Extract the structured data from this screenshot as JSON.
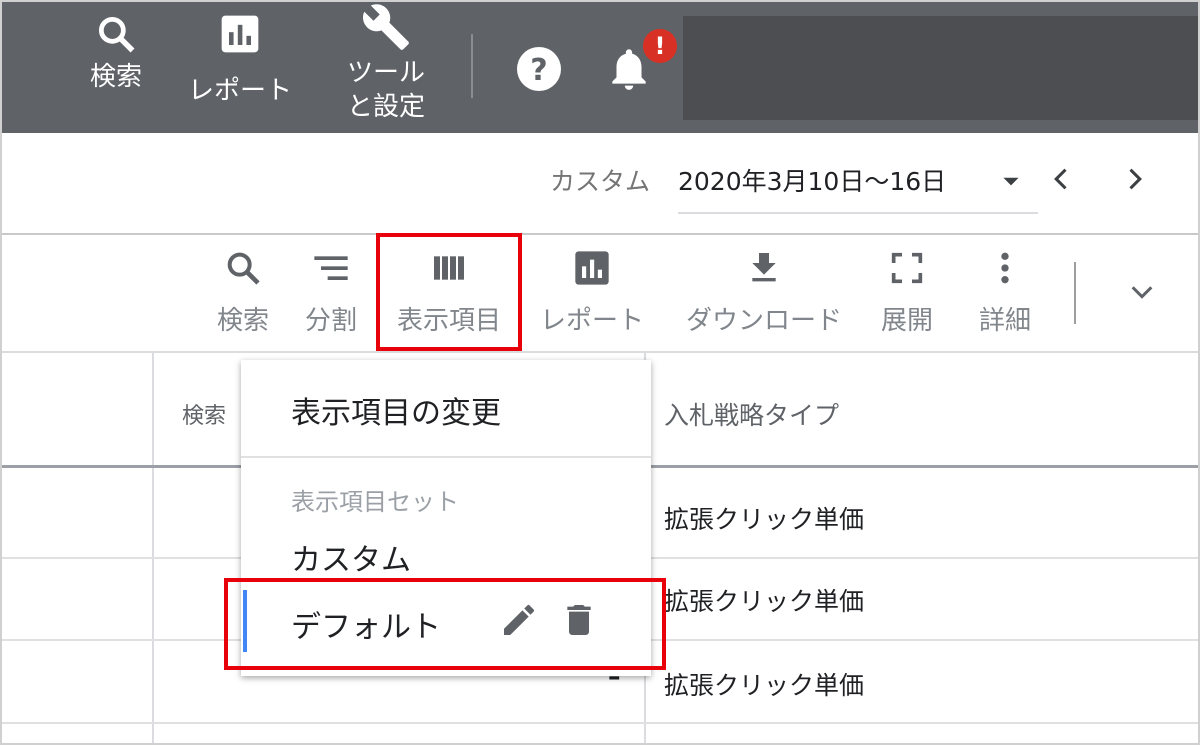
{
  "topbar": {
    "search_label": "検索",
    "reports_label": "レポート",
    "tools_label_line1": "ツール",
    "tools_label_line2": "と設定",
    "notification_badge": "!"
  },
  "date_range": {
    "label": "カスタム",
    "value": "2020年3月10日～16日"
  },
  "toolbar": {
    "search": "検索",
    "segment": "分割",
    "columns": "表示項目",
    "reports": "レポート",
    "download": "ダウンロード",
    "expand": "展開",
    "more": "詳細"
  },
  "table": {
    "header_partial": "検索",
    "header_bid_strategy": "入札戦略タイプ",
    "rows": [
      {
        "bid_strategy": "拡張クリック単価",
        "value": ""
      },
      {
        "bid_strategy": "拡張クリック単価",
        "value": ""
      },
      {
        "bid_strategy": "拡張クリック単価",
        "value": "–"
      }
    ]
  },
  "dropdown": {
    "title": "表示項目の変更",
    "section_label": "表示項目セット",
    "items": [
      "カスタム",
      "デフォルト"
    ]
  },
  "colors": {
    "topbar_bg": "#5f6368",
    "highlight_red": "#e8000b",
    "active_blue": "#4285f4",
    "badge_red": "#d93025"
  }
}
